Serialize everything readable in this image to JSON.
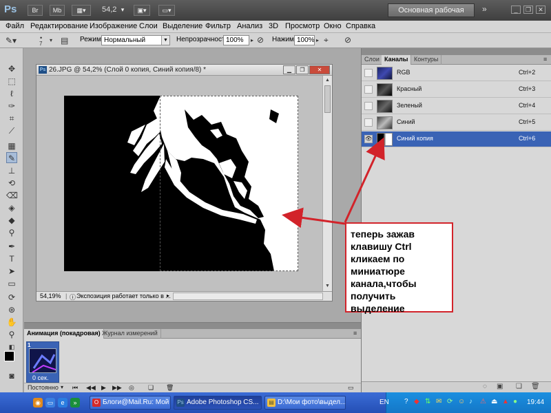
{
  "titlebar": {
    "logo": "Ps",
    "bridge_label": "Br",
    "minibridge_label": "Mb",
    "zoom": "54,2",
    "workspace": "Основная рабочая среда",
    "more_icon": "double-chevron-right-icon",
    "buttons": [
      "minimize-icon",
      "restore-icon",
      "close-icon"
    ]
  },
  "menu": [
    "Файл",
    "Редактирование",
    "Изображение",
    "Слои",
    "Выделение",
    "Фильтр",
    "Анализ",
    "3D",
    "Просмотр",
    "Окно",
    "Справка"
  ],
  "options": {
    "brush_size": "7",
    "mode_label": "Режим:",
    "mode_value": "Нормальный",
    "opacity_label": "Непрозрачность:",
    "opacity_value": "100%",
    "flow_label": "Нажим:",
    "flow_value": "100%"
  },
  "document": {
    "icon_label": "Ps",
    "title": "26.JPG @ 54,2% (Слой 0 копия, Синий копия/8) *",
    "zoom_status": "54,19%",
    "status_text": "Экспозиция работает только в ..."
  },
  "channels_panel": {
    "tabs": [
      {
        "label": "Слои",
        "active": false
      },
      {
        "label": "Каналы",
        "active": true
      },
      {
        "label": "Контуры",
        "active": false
      }
    ],
    "channels": [
      {
        "name": "RGB",
        "shortcut": "Ctrl+2",
        "visible": false,
        "selected": false
      },
      {
        "name": "Красный",
        "shortcut": "Ctrl+3",
        "visible": false,
        "selected": false
      },
      {
        "name": "Зеленый",
        "shortcut": "Ctrl+4",
        "visible": false,
        "selected": false
      },
      {
        "name": "Синий",
        "shortcut": "Ctrl+5",
        "visible": false,
        "selected": false
      },
      {
        "name": "Синий копия",
        "shortcut": "Ctrl+6",
        "visible": true,
        "selected": true
      }
    ]
  },
  "animation_panel": {
    "tabs": [
      {
        "label": "Анимация (покадровая)",
        "active": true
      },
      {
        "label": "Журнал измерений",
        "active": false
      }
    ],
    "frame_number": "1",
    "frame_duration": "0 сек.",
    "loop": "Постоянно"
  },
  "callout": {
    "lines": [
      "теперь зажав",
      "клавишу  Ctrl",
      "кликаем по",
      "миниатюре",
      "канала,чтобы",
      "получить",
      "выделение"
    ],
    "border_color": "#d2232a"
  },
  "taskbar": {
    "tasks": [
      {
        "label": "Блоги@Mail.Ru: Мой ...",
        "active": false
      },
      {
        "label": "Adobe Photoshop CS...",
        "active": true
      },
      {
        "label": "D:\\Мои фото\\выдел...",
        "active": false
      }
    ],
    "language": "EN",
    "time": "19:44"
  },
  "colors": {
    "accent": "#3a63b5",
    "callout_red": "#d2232a",
    "taskbar_blue": "#2b5bc8"
  }
}
